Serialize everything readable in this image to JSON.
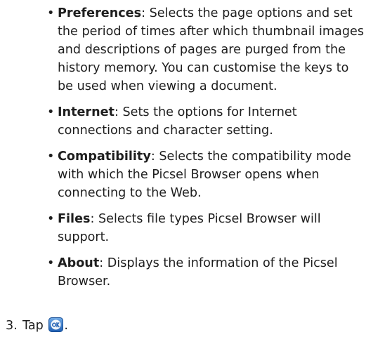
{
  "items": [
    {
      "term": "Preferences",
      "text": ": Selects the page options and set the period of times after which thumbnail images and descriptions of pages are purged from the history memory. You can customise the keys to be used when viewing a document."
    },
    {
      "term": "Internet",
      "text": ": Sets the options for Internet connections and character setting."
    },
    {
      "term": "Compatibility",
      "text": ": Selects the compatibility mode with which the Picsel Browser opens when connecting to the Web."
    },
    {
      "term": "Files",
      "text": ": Selects file types Picsel Browser will support."
    },
    {
      "term": "About",
      "text": ": Displays the information of the Picsel Browser."
    }
  ],
  "bullet_glyph": "•",
  "step": {
    "number": "3.",
    "text_before": "Tap",
    "text_after": ".",
    "icon": "ok-icon"
  }
}
